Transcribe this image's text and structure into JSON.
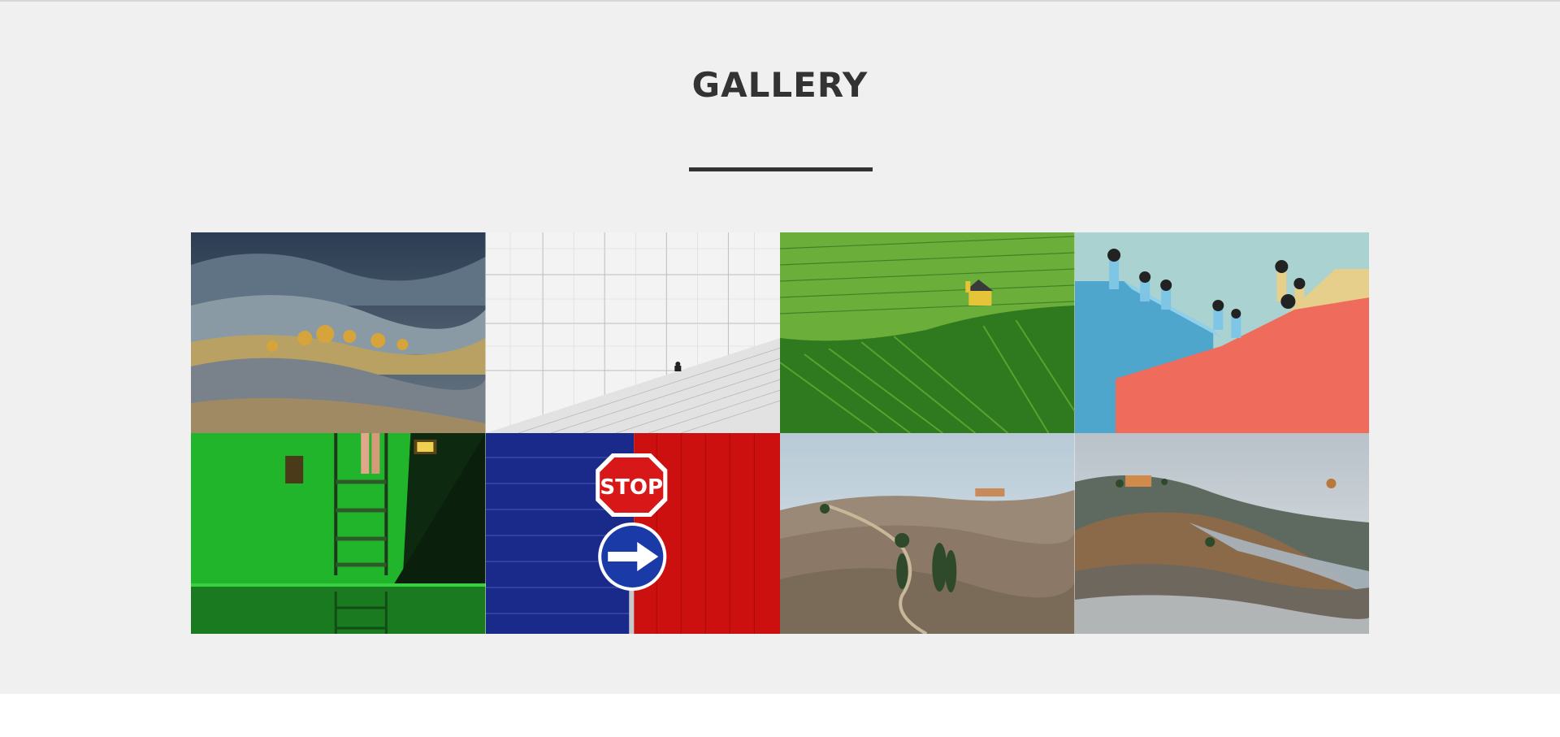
{
  "gallery": {
    "title": "GALLERY",
    "images": [
      {
        "id": "rolling-hills-trees",
        "colors": [
          "#3b4f66",
          "#7d8a8c",
          "#c79a3a"
        ]
      },
      {
        "id": "white-wall-stairs",
        "colors": [
          "#f4f4f4",
          "#cfcfcf",
          "#222222"
        ]
      },
      {
        "id": "vineyard-chapel",
        "colors": [
          "#3f8f2a",
          "#6fb43a",
          "#e2c43a"
        ]
      },
      {
        "id": "colorful-rooftops",
        "colors": [
          "#4fa3cc",
          "#ee6a5a",
          "#e6cf8a"
        ]
      },
      {
        "id": "green-pool-ladder",
        "colors": [
          "#22b22c",
          "#0e2a10",
          "#f0c27a"
        ]
      },
      {
        "id": "stop-sign-wall",
        "colors": [
          "#1a2e8a",
          "#cc1010",
          "#ffffff"
        ]
      },
      {
        "id": "tuscany-road-cypress",
        "colors": [
          "#8d7c68",
          "#c5d4dc",
          "#2f4a2a"
        ]
      },
      {
        "id": "foggy-tuscany-hills",
        "colors": [
          "#6f7e8a",
          "#a8835a",
          "#c9d3da"
        ]
      }
    ]
  }
}
